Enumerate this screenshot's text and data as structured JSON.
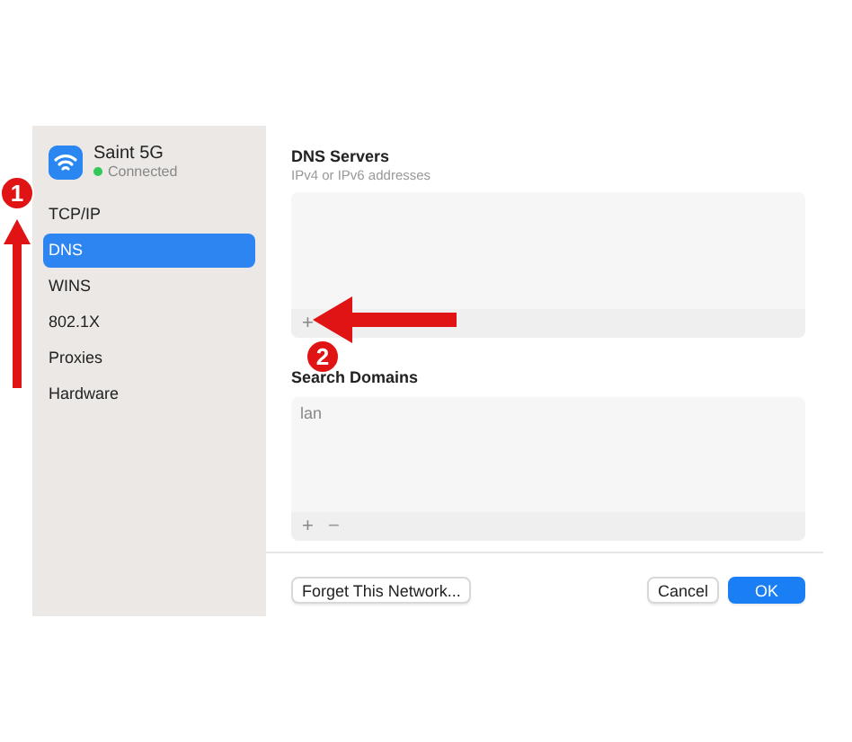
{
  "network": {
    "name": "Saint 5G",
    "status": "Connected"
  },
  "sidebar": {
    "items": [
      {
        "label": "TCP/IP",
        "selected": false
      },
      {
        "label": "DNS",
        "selected": true
      },
      {
        "label": "WINS",
        "selected": false
      },
      {
        "label": "802.1X",
        "selected": false
      },
      {
        "label": "Proxies",
        "selected": false
      },
      {
        "label": "Hardware",
        "selected": false
      }
    ]
  },
  "dns_servers": {
    "title": "DNS Servers",
    "subtitle": "IPv4 or IPv6 addresses",
    "add": "+"
  },
  "search_domains": {
    "title": "Search Domains",
    "entries": [
      "lan"
    ],
    "add": "+",
    "remove": "−"
  },
  "buttons": [
    {
      "label": "Forget This Network...",
      "kind": "plain"
    },
    {
      "label": "Cancel",
      "kind": "plain"
    },
    {
      "label": "OK",
      "kind": "primary"
    }
  ],
  "annotations": [
    {
      "label": "1",
      "kind": "up"
    },
    {
      "label": "2",
      "kind": "left"
    }
  ]
}
